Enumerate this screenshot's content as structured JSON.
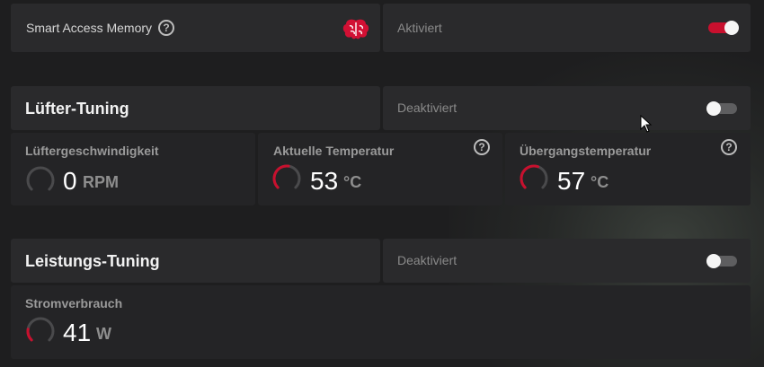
{
  "sam": {
    "label": "Smart Access Memory",
    "status": "Aktiviert",
    "help": "?",
    "brain_icon": "brain-icon",
    "toggle_on": true
  },
  "fan": {
    "title": "Lüfter-Tuning",
    "status": "Deaktiviert",
    "toggle_on": false,
    "metrics": [
      {
        "label": "Lüftergeschwindigkeit",
        "value": "0",
        "unit": "RPM",
        "fraction": 0.0,
        "help": ""
      },
      {
        "label": "Aktuelle Temperatur",
        "value": "53",
        "unit": "°C",
        "fraction": 0.53,
        "help": "?"
      },
      {
        "label": "Übergangstemperatur",
        "value": "57",
        "unit": "°C",
        "fraction": 0.57,
        "help": "?"
      }
    ]
  },
  "perf": {
    "title": "Leistungs-Tuning",
    "status": "Deaktiviert",
    "toggle_on": false,
    "metric": {
      "label": "Stromverbrauch",
      "value": "41",
      "unit": "W",
      "fraction": 0.2
    }
  },
  "colors": {
    "accent": "#c8102e",
    "panel": "#2a2a2c",
    "background": "#1e1e1f"
  }
}
